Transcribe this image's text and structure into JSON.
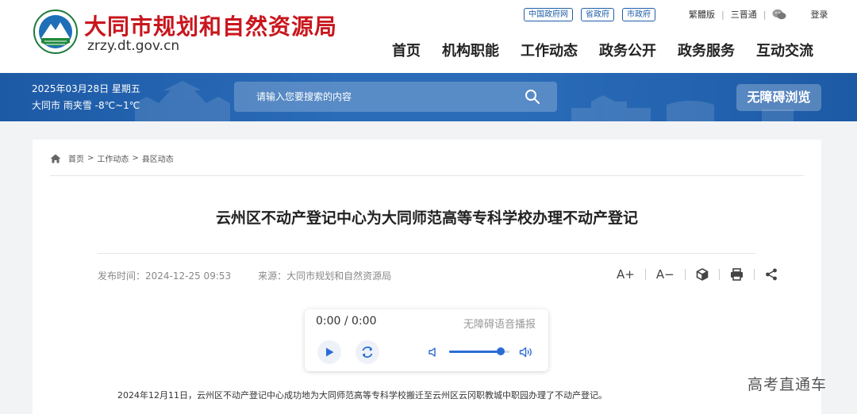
{
  "header": {
    "site_title": "大同市规划和自然资源局",
    "site_domain": "zrzy.dt.gov.cn",
    "gov_links": [
      "中国政府网",
      "省政府",
      "市政府"
    ],
    "traditional_label": "繁體版",
    "sanputong_label": "三晋通",
    "login_label": "登录",
    "nav": [
      "首页",
      "机构职能",
      "工作动态",
      "政务公开",
      "政务服务",
      "互动交流"
    ]
  },
  "banner": {
    "date": "2025年03月28日 星期五",
    "weather": "大同市 雨夹雪 -8℃~1℃",
    "search_placeholder": "请输入您要搜索的内容",
    "accessibility_label": "无障碍浏览"
  },
  "breadcrumb": [
    "首页",
    "工作动态",
    "县区动态"
  ],
  "breadcrumb_separator": ">",
  "article": {
    "title": "云州区不动产登记中心为大同师范高等专科学校办理不动产登记",
    "publish_label": "发布时间：2024-12-25 09:53",
    "source_label": "来源：大同市规划和自然资源局",
    "tools": [
      "A+",
      "A−"
    ],
    "body_first_line": "2024年12月11日，云州区不动产登记中心成功地为大同师范高等专科学校搬迁至云州区云冈职教城中职园办理了不动产登记。"
  },
  "player": {
    "time": "0:00 / 0:00",
    "label": "无障碍语音播报",
    "volume": 0.85
  },
  "watermark": "高考直通车",
  "colors": {
    "brand_red": "#c8161d",
    "banner_blue": "#2a6cb8",
    "player_accent": "#2a6cd6"
  },
  "icons": [
    "emblem-logo",
    "wechat-icon",
    "search-icon",
    "home-icon",
    "cube-icon",
    "print-icon",
    "share-icon",
    "play-icon",
    "replay-icon",
    "volume-low-icon",
    "volume-high-icon"
  ]
}
